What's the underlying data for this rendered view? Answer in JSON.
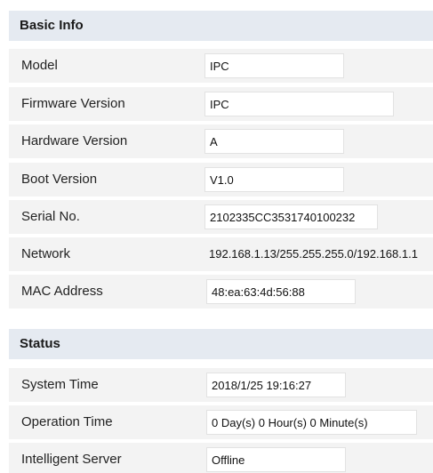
{
  "basic_info": {
    "title": "Basic Info",
    "rows": [
      {
        "label": "Model",
        "value": "IPC"
      },
      {
        "label": "Firmware Version",
        "value": "IPC"
      },
      {
        "label": "Hardware Version",
        "value": "A"
      },
      {
        "label": "Boot Version",
        "value": "V1.0"
      },
      {
        "label": "Serial No.",
        "value": "2102335CC3531740100232"
      },
      {
        "label": "Network",
        "value": "192.168.1.13/255.255.255.0/192.168.1.1"
      },
      {
        "label": "MAC Address",
        "value": "48:ea:63:4d:56:88"
      }
    ]
  },
  "status": {
    "title": "Status",
    "rows": [
      {
        "label": "System Time",
        "value": "2018/1/25 19:16:27"
      },
      {
        "label": "Operation Time",
        "value": "0 Day(s) 0 Hour(s) 0 Minute(s)"
      },
      {
        "label": "Intelligent Server",
        "value": "Offline"
      }
    ]
  }
}
